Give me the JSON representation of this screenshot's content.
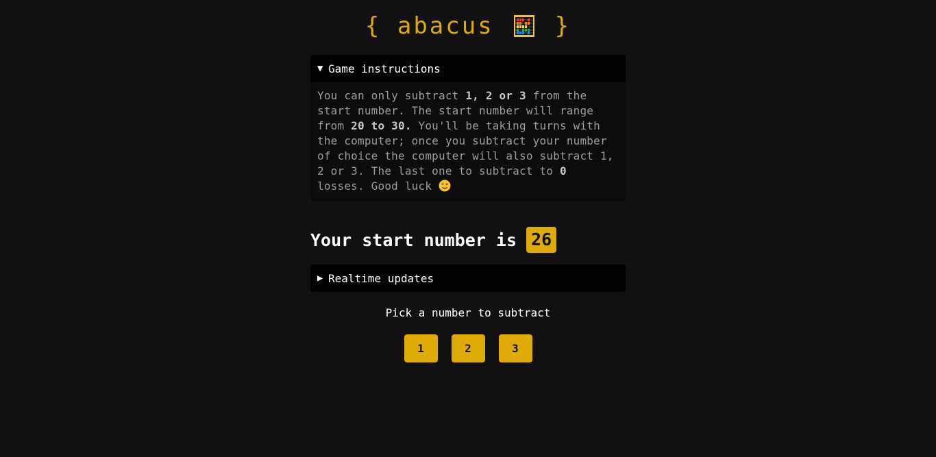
{
  "header": {
    "brace_open": "{",
    "title": "abacus",
    "icon": "abacus-icon",
    "brace_close": "}"
  },
  "instructions": {
    "summary_arrow": "▼",
    "summary_label": "Game instructions",
    "text_1": "You can only subtract ",
    "bold_1": "1, 2 or 3",
    "text_2": " from the start number. The start number will range from ",
    "bold_2": "20 to 30.",
    "text_3": " You'll be taking turns with the computer; once you subtract your number of choice the computer will also subtract 1, 2 or 3. The last one to subtract to ",
    "bold_3": "0",
    "text_4": " losses. Good luck ",
    "emoji_icon": "winking-face-icon"
  },
  "start": {
    "label": "Your start number is",
    "number": "26"
  },
  "updates": {
    "summary_arrow": "▶",
    "summary_label": "Realtime updates"
  },
  "prompt": "Pick a number to subtract",
  "buttons": [
    "1",
    "2",
    "3"
  ],
  "colors": {
    "background": "#111111",
    "accent": "#dfaa05",
    "panel": "#020202",
    "muted_text": "#9c9c9c"
  }
}
